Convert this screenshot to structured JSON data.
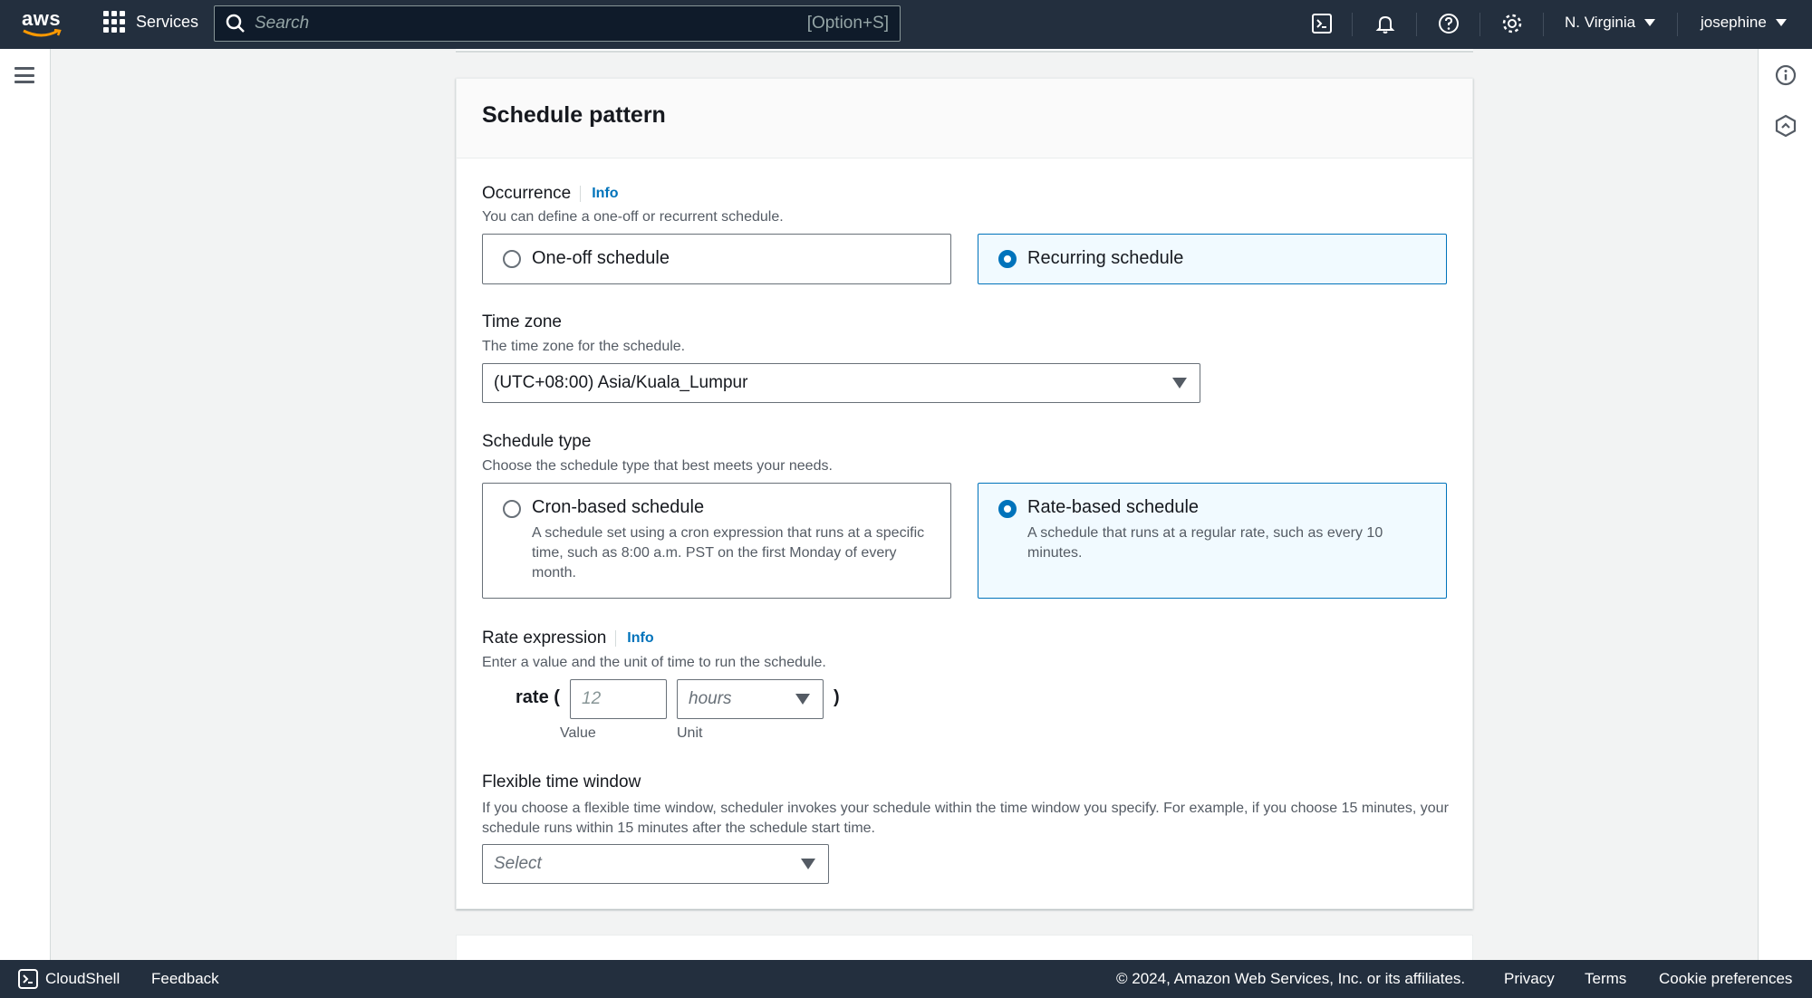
{
  "nav": {
    "logo_text": "aws",
    "services_label": "Services",
    "search_placeholder": "Search",
    "search_shortcut": "[Option+S]",
    "region_label": "N. Virginia",
    "user_label": "josephine"
  },
  "panel": {
    "title": "Schedule pattern",
    "occurrence": {
      "label": "Occurrence",
      "info": "Info",
      "description": "You can define a one-off or recurrent schedule.",
      "options": [
        {
          "label": "One-off schedule",
          "selected": false
        },
        {
          "label": "Recurring schedule",
          "selected": true
        }
      ]
    },
    "timezone": {
      "label": "Time zone",
      "description": "The time zone for the schedule.",
      "value": "(UTC+08:00) Asia/Kuala_Lumpur"
    },
    "schedule_type": {
      "label": "Schedule type",
      "description": "Choose the schedule type that best meets your needs.",
      "options": [
        {
          "title": "Cron-based schedule",
          "description": "A schedule set using a cron expression that runs at a specific time, such as 8:00 a.m. PST on the first Monday of every month.",
          "selected": false
        },
        {
          "title": "Rate-based schedule",
          "description": "A schedule that runs at a regular rate, such as every 10 minutes.",
          "selected": true
        }
      ]
    },
    "rate_expression": {
      "label": "Rate expression",
      "info": "Info",
      "description": "Enter a value and the unit of time to run the schedule.",
      "prefix": "rate (",
      "suffix": ")",
      "value_placeholder": "12",
      "unit_placeholder": "hours",
      "value_caption": "Value",
      "unit_caption": "Unit"
    },
    "flexible_window": {
      "label": "Flexible time window",
      "description": "If you choose a flexible time window, scheduler invokes your schedule within the time window you specify. For example, if you choose 15 minutes, your schedule runs within 15 minutes after the schedule start time.",
      "placeholder": "Select"
    }
  },
  "footer": {
    "cloudshell": "CloudShell",
    "feedback": "Feedback",
    "copyright": "© 2024, Amazon Web Services, Inc. or its affiliates.",
    "privacy": "Privacy",
    "terms": "Terms",
    "cookies": "Cookie preferences"
  },
  "colors": {
    "nav_bg": "#232f3e",
    "accent": "#0073bb",
    "selected_bg": "#f1faff"
  }
}
